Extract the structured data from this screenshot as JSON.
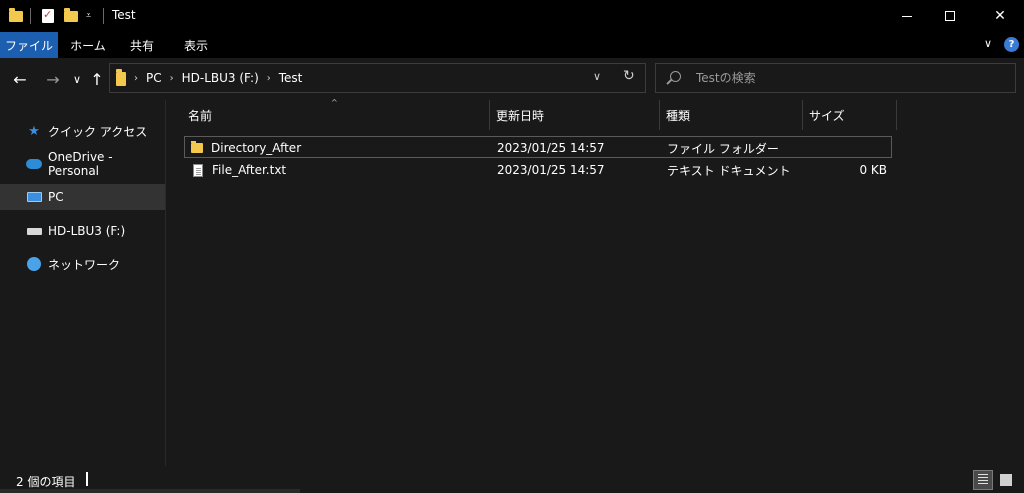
{
  "window": {
    "title": "Test",
    "minimize_symbol": "",
    "close_symbol": "✕"
  },
  "quick_access": {
    "dropdown_symbol": "⩡"
  },
  "ribbon": {
    "tabs": [
      "ファイル",
      "ホーム",
      "共有",
      "表示"
    ],
    "active_tab": "ファイル",
    "expand_symbol": "∨",
    "help_symbol": "?"
  },
  "nav": {
    "back_symbol": "←",
    "forward_symbol": "→",
    "recent_symbol": "∨",
    "up_symbol": "↑"
  },
  "address": {
    "breadcrumbs": [
      "PC",
      "HD-LBU3 (F:)",
      "Test"
    ],
    "separator": "›",
    "dropdown_symbol": "∨",
    "refresh_symbol": "↻"
  },
  "search": {
    "placeholder": "Testの検索",
    "value": ""
  },
  "sidebar": {
    "items": [
      {
        "label": "クイック アクセス",
        "icon": "quick-access-star-icon"
      },
      {
        "label": "OneDrive - Personal",
        "icon": "onedrive-cloud-icon"
      },
      {
        "label": "PC",
        "icon": "pc-icon"
      },
      {
        "label": "HD-LBU3 (F:)",
        "icon": "drive-icon"
      },
      {
        "label": "ネットワーク",
        "icon": "network-icon"
      }
    ],
    "selected": "PC"
  },
  "filelist": {
    "columns": [
      "名前",
      "更新日時",
      "種類",
      "サイズ"
    ],
    "sort_column": "名前",
    "sort_symbol": "^",
    "rows": [
      {
        "name": "Directory_After",
        "modified": "2023/01/25 14:57",
        "type": "ファイル フォルダー",
        "size": "",
        "icon": "folder-icon"
      },
      {
        "name": "File_After.txt",
        "modified": "2023/01/25 14:57",
        "type": "テキスト ドキュメント",
        "size": "0 KB",
        "icon": "text-file-icon"
      }
    ]
  },
  "status": {
    "item_count": "2 個の項目"
  },
  "colors": {
    "background": "#191919",
    "titlebar": "#000000",
    "accent": "#1c5fb0",
    "folder": "#f2c94c",
    "selection": "#333333"
  }
}
